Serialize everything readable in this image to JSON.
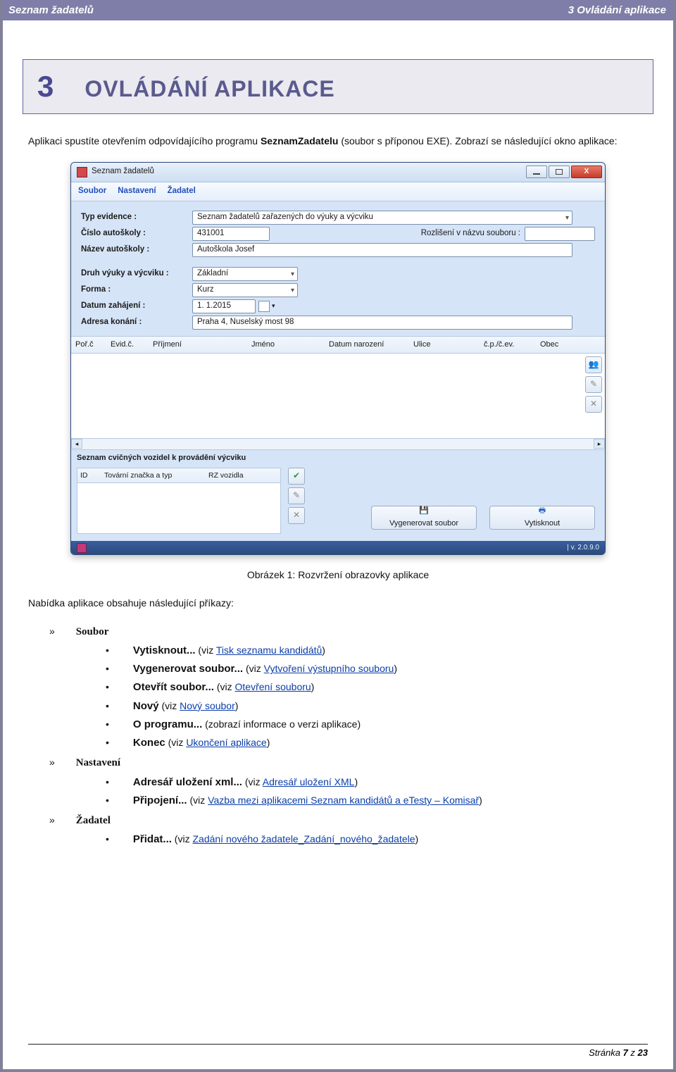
{
  "header": {
    "left": "Seznam žadatelů",
    "right": "3 Ovládání aplikace"
  },
  "chapter": {
    "num": "3",
    "title": "OVLÁDÁNÍ APLIKACE"
  },
  "intro": {
    "pre": "Aplikaci spustíte otevřením odpovídajícího programu ",
    "bold": "SeznamZadatelu",
    "post": " (soubor s příponou EXE). Zobrazí se následující okno aplikace:"
  },
  "window": {
    "title": "Seznam žadatelů",
    "menubar": [
      "Soubor",
      "Nastavení",
      "Žadatel"
    ],
    "fields": {
      "typeEvidence": {
        "label": "Typ evidence :",
        "value": "Seznam žadatelů zařazených do výuky a výcviku"
      },
      "schoolNumber": {
        "label": "Číslo autoškoly :",
        "value": "431001"
      },
      "fileResolution": {
        "label": "Rozlišení v názvu souboru :"
      },
      "schoolName": {
        "label": "Název autoškoly :",
        "value": "Autoškola Josef"
      },
      "trainingType": {
        "label": "Druh výuky a výcviku :",
        "value": "Základní"
      },
      "form": {
        "label": "Forma :",
        "value": "Kurz"
      },
      "startDate": {
        "label": "Datum zahájení :",
        "value": "1. 1.2015"
      },
      "address": {
        "label": "Adresa konání :",
        "value": "Praha 4, Nuselský most 98"
      }
    },
    "tableColumns": {
      "porc": "Poř.č",
      "evid": "Evid.č.",
      "prij": "Příjmení",
      "jmeno": "Jméno",
      "dat": "Datum narození",
      "ulice": "Ulice",
      "cp": "č.p./č.ev.",
      "obec": "Obec"
    },
    "sideTools": {
      "add": "👥",
      "edit": "✎",
      "del": "✕"
    },
    "vehicleCaption": "Seznam cvičných vozidel k provádění výcviku",
    "vehicleColumns": {
      "id": "ID",
      "brand": "Tovární značka a typ",
      "rz": "RZ vozidla"
    },
    "vehicleTools": {
      "ok": "✔",
      "edit": "✎",
      "del": "✕"
    },
    "bottomButtons": {
      "generate": "Vygenerovat soubor",
      "print": "Vytisknout"
    },
    "status": "| v. 2.0.9.0"
  },
  "caption": "Obrázek 1: Rozvržení obrazovky aplikace",
  "menuHeader": "Nabídka aplikace obsahuje následující příkazy:",
  "menus": {
    "soubor": {
      "name": "Soubor",
      "items": {
        "vytisknout": {
          "cmd": "Vytisknout...",
          "viz": " (viz ",
          "link": "Tisk seznamu kandidátů",
          "after": ")"
        },
        "vygenerovat": {
          "cmd": "Vygenerovat soubor...",
          "viz": " (viz ",
          "link": "Vytvoření výstupního souboru",
          "after": ")"
        },
        "otevrit": {
          "cmd": "Otevřít soubor...",
          "viz": " (viz ",
          "link": "Otevření souboru",
          "after": ")"
        },
        "novy": {
          "cmd": "Nový",
          "viz": "  (viz ",
          "link": "Nový soubor",
          "after": ")"
        },
        "oprog": {
          "cmd": "O programu...",
          "after": " (zobrazí informace o verzi aplikace)"
        },
        "konec": {
          "cmd": "Konec",
          "viz": " (viz ",
          "link": "Ukončení aplikace",
          "after": ")"
        }
      }
    },
    "nastaveni": {
      "name": "Nastavení",
      "items": {
        "adresar": {
          "cmd": "Adresář uložení xml...",
          "viz": " (viz ",
          "link": "Adresář uložení XML",
          "after": ")"
        },
        "pripojeni": {
          "cmd": "Připojení...",
          "viz": " (viz ",
          "link": "Vazba mezi aplikacemi Seznam kandidátů a eTesty – Komisař",
          "after": ")"
        }
      }
    },
    "zadatel": {
      "name": "Žadatel",
      "items": {
        "pridat": {
          "cmd": "Přidat...",
          "viz": " (viz ",
          "link": "Zadání nového žadatele_Zadání_nového_žadatele",
          "after": ")"
        }
      }
    }
  },
  "footer": {
    "label": "Stránka ",
    "page": "7",
    "of": " z ",
    "total": "23"
  }
}
